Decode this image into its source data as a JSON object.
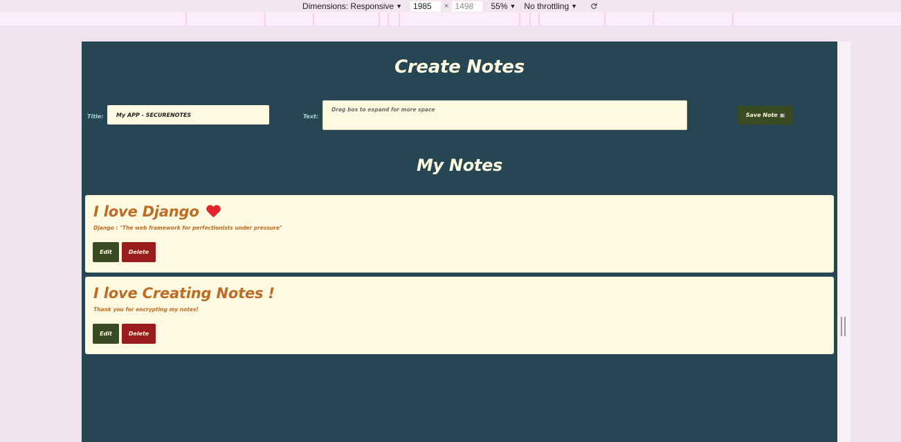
{
  "devtools": {
    "dimensions_label": "Dimensions: Responsive",
    "width_value": "1985",
    "times": "×",
    "height_value": "1498",
    "zoom": "55%",
    "throttling": "No throttling"
  },
  "page": {
    "heading": "Create Notes",
    "form": {
      "title_label": "Title:",
      "title_value": "My APP - SECURENOTES",
      "text_label": "Text:",
      "text_placeholder": "Drag box to expand for more space",
      "save_label": "Save Note"
    },
    "notes_heading": "My Notes",
    "notes": [
      {
        "title": "I love Django",
        "has_heart": true,
        "body": "Django : \"The web framework for perfectionists under pressure\"",
        "edit_label": "Edit",
        "delete_label": "Delete"
      },
      {
        "title": "I love Creating Notes !",
        "has_heart": false,
        "body": "Thank you for encrypting my notes!",
        "edit_label": "Edit",
        "delete_label": "Delete"
      }
    ]
  },
  "colors": {
    "page_background": "#264653",
    "card_background": "#fef9e1",
    "note_text": "#bc6c25",
    "edit_button": "#3a4a22",
    "delete_button": "#9b1c1c",
    "label_color": "#a8dadc"
  }
}
